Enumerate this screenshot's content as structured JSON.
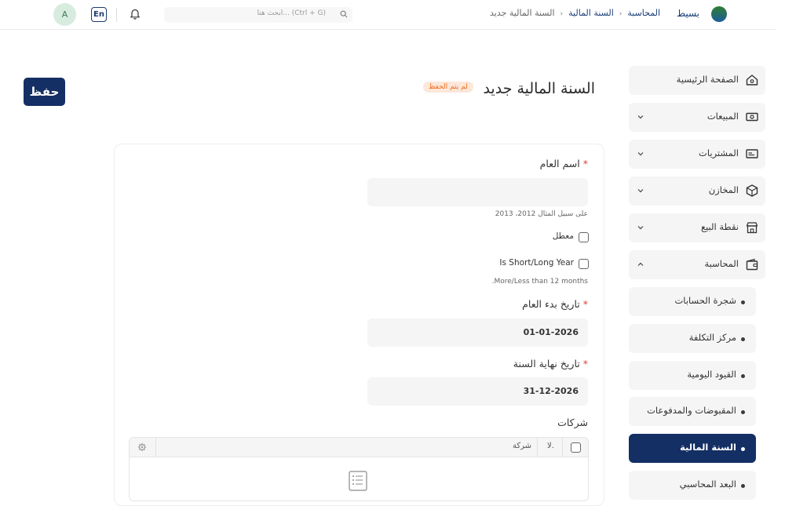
{
  "topbar": {
    "brand": "بسيط",
    "breadcrumbs": [
      "المحاسبة",
      "السنة المالية",
      "السنة المالية جديد"
    ],
    "search_placeholder": "ابحث هنا... (Ctrl + G)",
    "lang_label": "En",
    "avatar_initial": "A"
  },
  "header": {
    "title": "السنة المالية جديد",
    "status_badge": "لم يتم الحفظ",
    "save_label": "حفظ",
    "accent_color": "#142f64",
    "badge_color": "#f26b1d"
  },
  "sidebar": {
    "items": [
      {
        "label": "الصفحة الرئيسية",
        "icon": "home-icon"
      },
      {
        "label": "المبيعات",
        "icon": "cash-icon"
      },
      {
        "label": "المشتريات",
        "icon": "id-card-icon"
      },
      {
        "label": "المخازن",
        "icon": "box-icon"
      },
      {
        "label": "نقطة البيع",
        "icon": "store-icon"
      },
      {
        "label": "المحاسبة",
        "icon": "wallet-icon"
      }
    ],
    "sub_items": [
      {
        "label": "شجرة الحسابات"
      },
      {
        "label": "مركز التكلفة"
      },
      {
        "label": "القيود اليومية"
      },
      {
        "label": "المقبوضات والمدفوعات"
      },
      {
        "label": "السنة المالية"
      },
      {
        "label": "البعد المحاسبي"
      }
    ]
  },
  "form": {
    "year_name": {
      "label": "اسم العام",
      "value": "",
      "hint": "على سبيل المثال 2012، 2013"
    },
    "disabled": {
      "label": "معطل",
      "checked": false
    },
    "short_long": {
      "label": "Is Short/Long Year",
      "checked": false,
      "hint": "More/Less than 12 months."
    },
    "start_date": {
      "label": "تاريخ بدء العام",
      "value": "01-01-2026"
    },
    "end_date": {
      "label": "تاريخ نهاية السنة",
      "value": "31-12-2026"
    },
    "companies": {
      "label": "شركات",
      "col_no": "لا.",
      "col_company": "شركة"
    }
  }
}
